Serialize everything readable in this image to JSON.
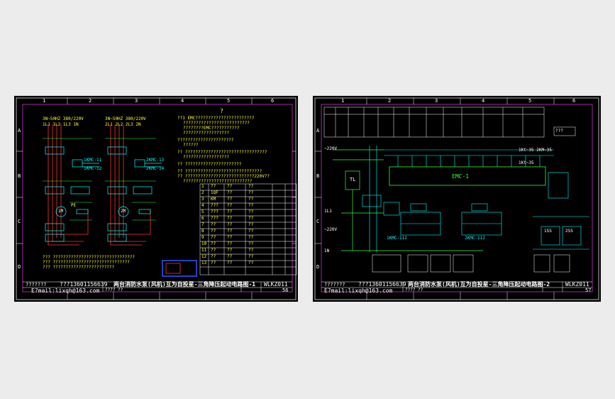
{
  "sheets": [
    {
      "id": "left",
      "column_numbers": [
        "1",
        "2",
        "3",
        "4",
        "5",
        "6"
      ],
      "row_letters": [
        "A",
        "B",
        "C",
        "D"
      ],
      "circuit_labels": {
        "supply_1": "3N~50HZ 380/220V",
        "phases_1": "1L1 1L2 1L3 1N",
        "supply_2": "3N~50HZ 380/220V",
        "phases_2": "2L1 2L2 2L3 2N",
        "kmc_1": "1KMC-11",
        "kmc_2": "1KMC-12",
        "kmc_3": "2KMC-13",
        "kmc_4": "2KMC-14",
        "motor_1": "1M",
        "motor_2": "2M",
        "pe": "PE"
      },
      "notes_top": "?",
      "notes_lines": [
        "??1 EMC???????????????????????",
        "??????????????????????????",
        "????????EMC???????????",
        "??????????????????",
        "??????????????????????",
        "??????",
        "?? ????????????????????????????????",
        "??????????????????",
        "?? ??????????????????????",
        "?? ??????????????????????????????",
        "?? ???????????????????????????220V??",
        "???????????????????????????"
      ],
      "bottom_notes": [
        "??? ????????????????????????????????",
        "??? ??????????????????????????????",
        "??? ????????????????????????"
      ],
      "table_rows": [
        [
          "1",
          "??",
          "??",
          "??"
        ],
        [
          "2",
          "1QF",
          "??",
          "??"
        ],
        [
          "3",
          "KM",
          "??",
          "??"
        ],
        [
          "4",
          "???",
          "??",
          "??"
        ],
        [
          "5",
          "???",
          "??",
          "??"
        ],
        [
          "6",
          "???",
          "??",
          "??"
        ],
        [
          "7",
          "??",
          "??",
          "??"
        ],
        [
          "8",
          "??",
          "??",
          "??"
        ],
        [
          "9",
          "??",
          "??",
          "??"
        ],
        [
          "10",
          "??",
          "??",
          "??"
        ],
        [
          "11",
          "??",
          "??",
          "??"
        ],
        [
          "12",
          "??",
          "??",
          "??"
        ],
        [
          "13",
          "??",
          "??",
          "??"
        ]
      ],
      "title_block": {
        "designer": "???????",
        "contact": "???13601156639",
        "email": "E?mail:lixqh@163.com",
        "title": "两台消防水泵(风机)互为自投星-三角降压起动电路图-1",
        "code": "WLKZ011",
        "sheet_no": "56",
        "sub": "???? ??"
      }
    },
    {
      "id": "right",
      "column_numbers": [
        "1",
        "2",
        "3",
        "4",
        "5",
        "6"
      ],
      "row_letters": [
        "A",
        "B",
        "C",
        "D"
      ],
      "circuit_labels": {
        "emc": "EMC-1",
        "v1": "~220V",
        "v2": "~220V",
        "tl": "TL",
        "kmc_a": "1KMC-112",
        "kmc_b": "2KMC-112",
        "r1": "1SS",
        "r2": "2SS",
        "t1": "1Kt~35 2KM~35",
        "t2": "1Kt~35",
        "h1": "1L1",
        "h2": "1N",
        "top_ref": "???"
      },
      "title_block": {
        "designer": "???????",
        "contact": "???13601156639",
        "email": "E?mail:lixqh@163.com",
        "title": "两台消防水泵(风机)互为自投星-三角降压起动电路图-2",
        "code": "WLKZ011",
        "sheet_no": "57",
        "sub": "???? ??"
      }
    }
  ],
  "colors": {
    "frame": "#cc33cc",
    "wire_cyan": "#00ffff",
    "wire_green": "#33ff33",
    "wire_red": "#ff3333",
    "text_yellow": "#ffff33",
    "white": "#ffffff",
    "stamp_blue": "#3355ff"
  }
}
